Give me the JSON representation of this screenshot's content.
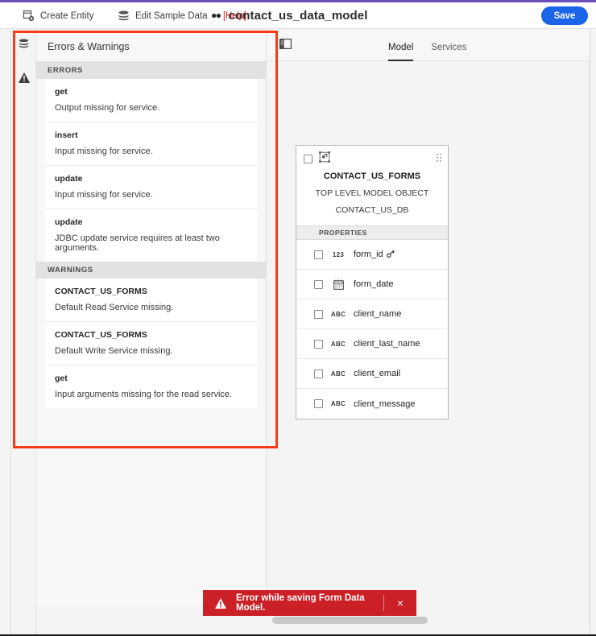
{
  "window": {
    "document_title": "contact_us_data_model"
  },
  "toolbar": {
    "create_entity_label": "Create Entity",
    "create_entity_icon": "create-entity-icon",
    "edit_sample_data_label": "Edit Sample Data",
    "edit_sample_data_icon": "database-stack-icon",
    "help_label": "[Help]",
    "help_icon": "link-glasses-icon",
    "save_label": "Save",
    "save_color": "#1c64e8",
    "help_color": "#e02020"
  },
  "rail": {
    "items": [
      {
        "name": "database-icon",
        "title": "Data Sources"
      },
      {
        "name": "warning-triangle-icon",
        "title": "Errors & Warnings"
      }
    ]
  },
  "errors_panel": {
    "title": "Errors & Warnings",
    "sections": [
      {
        "label": "ERRORS",
        "items": [
          {
            "title": "get",
            "message": "Output missing for service."
          },
          {
            "title": "insert",
            "message": "Input missing for service."
          },
          {
            "title": "update",
            "message": "Input missing for service."
          },
          {
            "title": "update",
            "message": "JDBC update service requires at least two arguments."
          }
        ]
      },
      {
        "label": "WARNINGS",
        "items": [
          {
            "title": "CONTACT_US_FORMS",
            "message": "Default Read Service missing."
          },
          {
            "title": "CONTACT_US_FORMS",
            "message": "Default Write Service missing."
          },
          {
            "title": "get",
            "message": "Input arguments missing for the read service."
          }
        ]
      }
    ]
  },
  "canvas": {
    "panel_toggle_icon": "panel-toggle-icon",
    "tabs": [
      {
        "label": "Model",
        "active": true
      },
      {
        "label": "Services",
        "active": false
      }
    ]
  },
  "entity": {
    "icon": "entity-object-icon",
    "drag_handle_icon": "drag-handle-icon",
    "name": "CONTACT_US_FORMS",
    "subtitle": "TOP LEVEL MODEL OBJECT",
    "datasource": "CONTACT_US_DB",
    "properties_label": "PROPERTIES",
    "properties": [
      {
        "type_icon": "number-type-icon",
        "type_label": "123",
        "name": "form_id",
        "key": true
      },
      {
        "type_icon": "date-type-icon",
        "type_label": "",
        "name": "form_date",
        "key": false
      },
      {
        "type_icon": "text-type-icon",
        "type_label": "ABC",
        "name": "client_name",
        "key": false
      },
      {
        "type_icon": "text-type-icon",
        "type_label": "ABC",
        "name": "client_last_name",
        "key": false
      },
      {
        "type_icon": "text-type-icon",
        "type_label": "ABC",
        "name": "client_email",
        "key": false
      },
      {
        "type_icon": "text-type-icon",
        "type_label": "ABC",
        "name": "client_message",
        "key": false
      }
    ]
  },
  "toast": {
    "icon": "warning-triangle-icon",
    "message": "Error while saving Form Data Model.",
    "close_label": "×",
    "background_color": "#cc2027"
  },
  "annotation": {
    "color": "#f93a17"
  }
}
